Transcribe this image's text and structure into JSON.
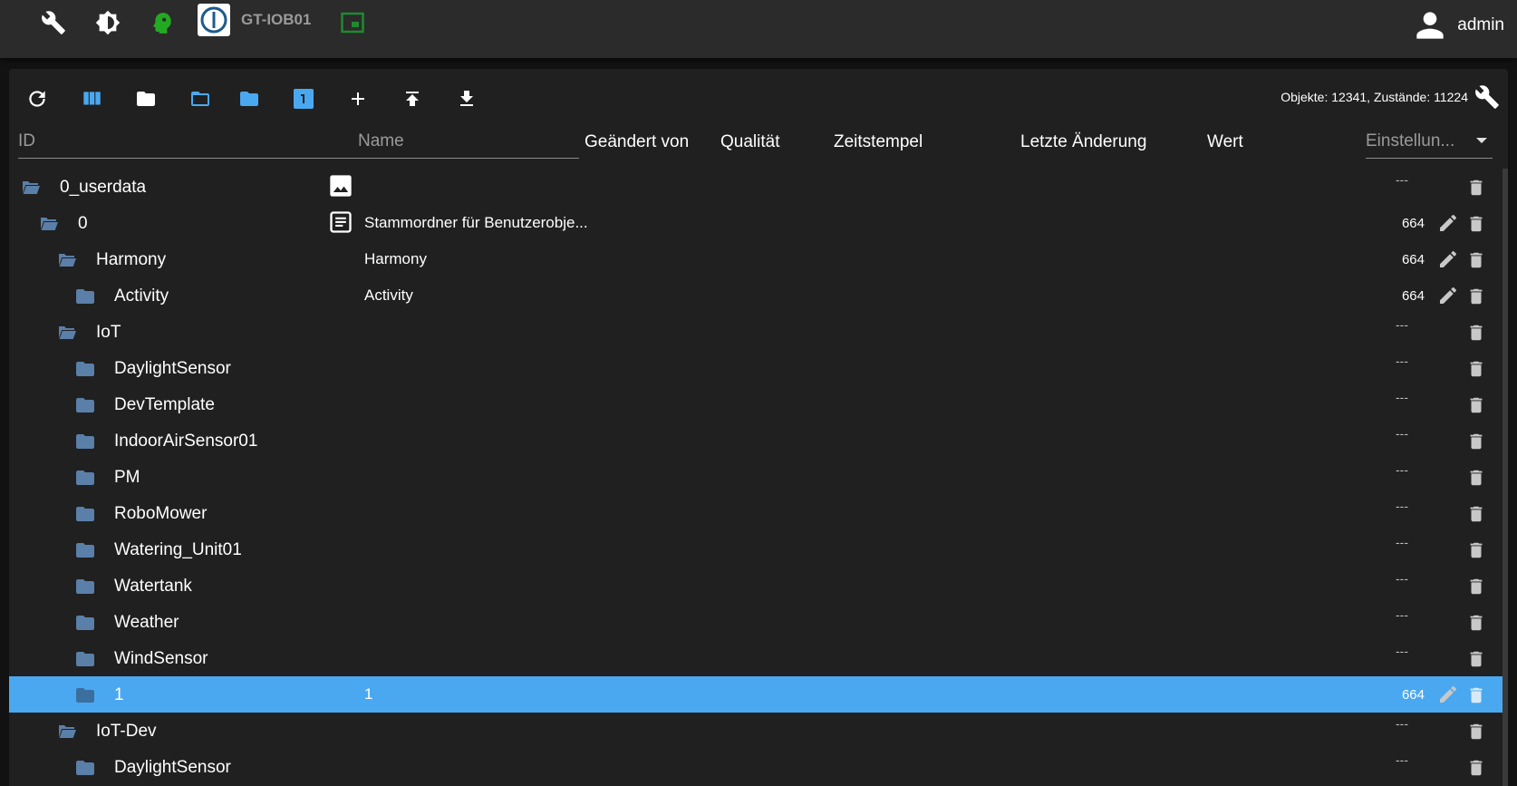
{
  "appbar": {
    "hostname": "GT-IOB01",
    "user": "admin",
    "icons": [
      "wrench-icon",
      "brightness-icon",
      "expert-head-icon",
      "iobroker-logo",
      "window-icon",
      "account-icon"
    ]
  },
  "toolbar": {
    "stats": "Objekte: 12341, Zustände: 11224",
    "icons": [
      "refresh-icon",
      "columns-icon",
      "folder-icon",
      "folder-open-icon",
      "folder-blue-icon",
      "page-1-icon",
      "add-icon",
      "upload-icon",
      "download-icon",
      "wrench-icon"
    ]
  },
  "columns": {
    "id_placeholder": "ID",
    "name_placeholder": "Name",
    "changed_by": "Geändert von",
    "quality": "Qualität",
    "timestamp": "Zeitstempel",
    "last_change": "Letzte Änderung",
    "value": "Wert",
    "settings": "Einstellun..."
  },
  "rows": [
    {
      "id": "0_userdata",
      "level": 0,
      "open": true,
      "name": "",
      "type": "image",
      "acl": "---",
      "edit": false
    },
    {
      "id": "0",
      "level": 1,
      "open": true,
      "name": "Stammordner für Benutzerobje...",
      "type": "doc",
      "acl": "664",
      "edit": true
    },
    {
      "id": "Harmony",
      "level": 2,
      "open": true,
      "name": "Harmony",
      "type": "",
      "acl": "664",
      "edit": true
    },
    {
      "id": "Activity",
      "level": 3,
      "open": false,
      "name": "Activity",
      "type": "",
      "acl": "664",
      "edit": true
    },
    {
      "id": "IoT",
      "level": 2,
      "open": true,
      "name": "",
      "type": "",
      "acl": "---",
      "edit": false
    },
    {
      "id": "DaylightSensor",
      "level": 3,
      "open": false,
      "name": "",
      "type": "",
      "acl": "---",
      "edit": false
    },
    {
      "id": "DevTemplate",
      "level": 3,
      "open": false,
      "name": "",
      "type": "",
      "acl": "---",
      "edit": false
    },
    {
      "id": "IndoorAirSensor01",
      "level": 3,
      "open": false,
      "name": "",
      "type": "",
      "acl": "---",
      "edit": false
    },
    {
      "id": "PM",
      "level": 3,
      "open": false,
      "name": "",
      "type": "",
      "acl": "---",
      "edit": false
    },
    {
      "id": "RoboMower",
      "level": 3,
      "open": false,
      "name": "",
      "type": "",
      "acl": "---",
      "edit": false
    },
    {
      "id": "Watering_Unit01",
      "level": 3,
      "open": false,
      "name": "",
      "type": "",
      "acl": "---",
      "edit": false
    },
    {
      "id": "Watertank",
      "level": 3,
      "open": false,
      "name": "",
      "type": "",
      "acl": "---",
      "edit": false
    },
    {
      "id": "Weather",
      "level": 3,
      "open": false,
      "name": "",
      "type": "",
      "acl": "---",
      "edit": false
    },
    {
      "id": "WindSensor",
      "level": 3,
      "open": false,
      "name": "",
      "type": "",
      "acl": "---",
      "edit": false
    },
    {
      "id": "1",
      "level": 3,
      "open": false,
      "name": "1",
      "type": "",
      "acl": "664",
      "edit": true,
      "selected": true
    },
    {
      "id": "IoT-Dev",
      "level": 2,
      "open": true,
      "name": "",
      "type": "",
      "acl": "---",
      "edit": false
    },
    {
      "id": "DaylightSensor",
      "level": 3,
      "open": false,
      "name": "",
      "type": "",
      "acl": "---",
      "edit": false
    }
  ],
  "colors": {
    "selected": "#4aa8f0",
    "folder": "#5a7fa8",
    "appbar": "#2b2b2b",
    "panel": "#202020"
  }
}
